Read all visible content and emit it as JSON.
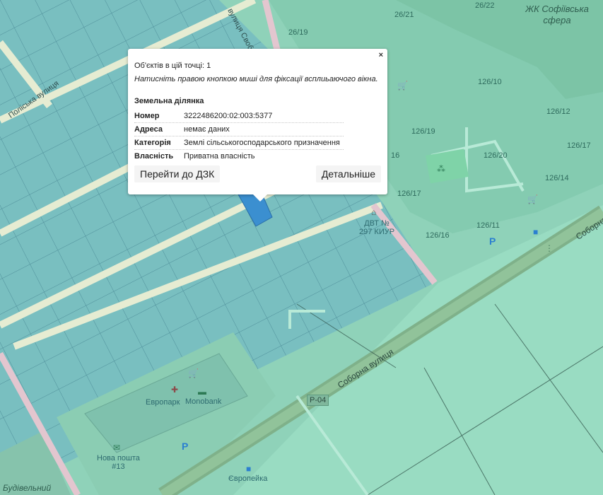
{
  "map": {
    "labels": {
      "polis_street": "Поліська вулиця",
      "svobody_street": "вулиця Свободи",
      "sobornа_street_1": "Соборна вулиця",
      "sobornа_street_2": "Соборна",
      "route": "P-04",
      "complex": "ЖК Софіївська сфера",
      "dvt": "ДВТ №",
      "dvt2": "297 КИУР",
      "europark": "Европарк",
      "monobank": "Monobank",
      "nova_poshta": "Нова пошта",
      "nova_poshta_num": "#13",
      "europeika": "Європейка",
      "budivelnyi": "Будівельний",
      "n_26_21": "26/21",
      "n_26_22": "26/22",
      "n_26_19": "26/19",
      "n_126_10": "126/10",
      "n_126_12": "126/12",
      "n_126_19": "126/19",
      "n_126_17": "126/17",
      "n_126_20": "126/20",
      "n_126_14": "126/14",
      "n_126_17b": "126/17",
      "n_126_11": "126/11",
      "n_126_16": "126/16",
      "n_16": "16"
    },
    "icons": [
      "shopping-cart-icon",
      "parking-icon",
      "bus-stop-icon",
      "traffic-light-icon",
      "pharmacy-icon",
      "bank-icon",
      "mail-icon",
      "tram-depot-icon",
      "playground-icon"
    ]
  },
  "popup": {
    "objects_count": "Об'єктів в цій точці: 1",
    "hint": "Натисніть правою кнопкою миші для фіксації всплиьаючого вікна.",
    "close": "×",
    "section_title": "Земельна ділянка",
    "rows": [
      {
        "key": "Номер",
        "value": "3222486200:02:003:5377"
      },
      {
        "key": "Адреса",
        "value": "немає даних"
      },
      {
        "key": "Категорія",
        "value": "Землі сільськогосподарського призначення"
      },
      {
        "key": "Власність",
        "value": "Приватна власність"
      }
    ],
    "go_button": "Перейти до ДЗК",
    "details_button": "Детальніше"
  }
}
